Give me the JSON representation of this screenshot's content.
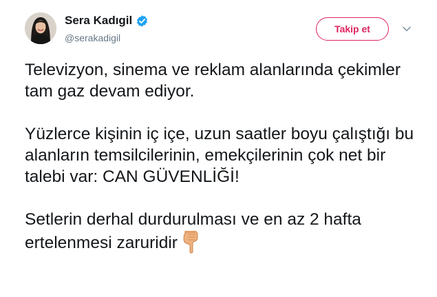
{
  "user": {
    "display_name": "Sera Kadıgil",
    "handle": "@serakadigil",
    "verified": true
  },
  "follow_button": {
    "label": "Takip et"
  },
  "tweet": {
    "paragraphs": [
      "Televizyon, sinema ve reklam alanlarında çekimler tam gaz devam ediyor.",
      "Yüzlerce kişinin iç içe, uzun saatler boyu çalıştığı bu alanların temsilcilerinin, emekçilerinin çok net bir talebi var: CAN GÜVENLİĞİ!",
      "Setlerin derhal durdurulması ve en az 2 hafta ertelenmesi zaruridir"
    ],
    "trailing_emoji": "backhand-index-pointing-down"
  },
  "colors": {
    "follow_accent": "#e0245e",
    "verified_blue": "#1da1f2",
    "text": "#14171a",
    "secondary_text": "#657786"
  }
}
